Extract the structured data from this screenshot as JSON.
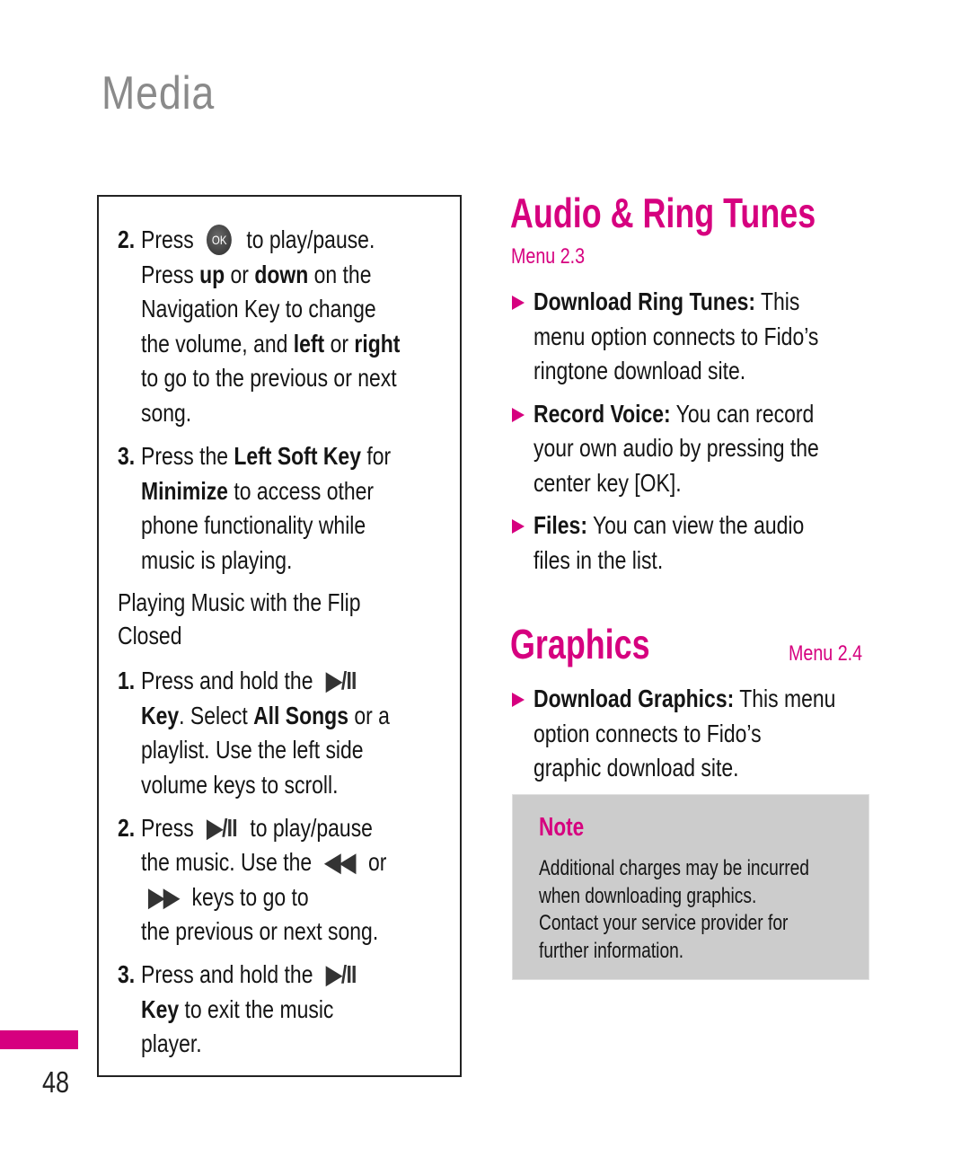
{
  "page": {
    "section_title": "Media",
    "page_number": "48",
    "accent_color": "#d6007f"
  },
  "left_box": {
    "flip_open_steps": [
      {
        "number": "2.",
        "lines": [
          {
            "parts": [
              {
                "t": "Press "
              },
              {
                "icon": "ok-button-icon",
                "label": "OK"
              },
              {
                "t": " to play/pause."
              }
            ]
          },
          {
            "parts": [
              {
                "t": "Press "
              },
              {
                "b": "up"
              },
              {
                "t": " or "
              },
              {
                "b": "down"
              },
              {
                "t": " on the"
              }
            ]
          },
          {
            "parts": [
              {
                "t": "Navigation Key to change"
              }
            ]
          },
          {
            "parts": [
              {
                "t": "the volume, and "
              },
              {
                "b": "left"
              },
              {
                "t": " or "
              },
              {
                "b": "right"
              }
            ]
          },
          {
            "parts": [
              {
                "t": "to go to the previous or next"
              }
            ]
          },
          {
            "parts": [
              {
                "t": "song."
              }
            ]
          }
        ]
      },
      {
        "number": "3.",
        "lines": [
          {
            "parts": [
              {
                "t": "Press the "
              },
              {
                "b": "Left Soft Key"
              },
              {
                "t": " for"
              }
            ]
          },
          {
            "parts": [
              {
                "b": "Minimize"
              },
              {
                "t": " to access other"
              }
            ]
          },
          {
            "parts": [
              {
                "t": "phone functionality while"
              }
            ]
          },
          {
            "parts": [
              {
                "t": "music is playing."
              }
            ]
          }
        ]
      }
    ],
    "subheading_lines": [
      "Playing Music with the Flip",
      "Closed"
    ],
    "flip_closed_steps": [
      {
        "number": "1.",
        "lines": [
          {
            "parts": [
              {
                "t": "Press and hold the "
              },
              {
                "icon": "play-pause-icon",
                "label": "▶/II"
              }
            ]
          },
          {
            "parts": [
              {
                "b": "Key"
              },
              {
                "t": ". Select "
              },
              {
                "b": "All Songs"
              },
              {
                "t": " or a"
              }
            ]
          },
          {
            "parts": [
              {
                "t": "playlist. Use the left side"
              }
            ]
          },
          {
            "parts": [
              {
                "t": "volume keys to scroll."
              }
            ]
          }
        ]
      },
      {
        "number": "2.",
        "lines": [
          {
            "parts": [
              {
                "t": "Press "
              },
              {
                "icon": "play-pause-icon",
                "label": "▶/II"
              },
              {
                "t": " to play/pause"
              }
            ]
          },
          {
            "parts": [
              {
                "t": "the music. Use the "
              },
              {
                "icon": "rewind-icon",
                "label": "◀◀"
              },
              {
                "t": " or"
              }
            ]
          },
          {
            "parts": [
              {
                "icon": "fast-forward-icon",
                "label": "▶▶"
              },
              {
                "t": " keys to go to"
              }
            ]
          },
          {
            "parts": [
              {
                "t": "the previous or next song."
              }
            ]
          }
        ]
      },
      {
        "number": "3.",
        "lines": [
          {
            "parts": [
              {
                "t": "Press and hold the "
              },
              {
                "icon": "play-pause-icon",
                "label": "▶/II"
              }
            ]
          },
          {
            "parts": [
              {
                "b": "Key"
              },
              {
                "t": " to exit the music"
              }
            ]
          },
          {
            "parts": [
              {
                "t": "player."
              }
            ]
          }
        ]
      }
    ]
  },
  "audio_section": {
    "title": "Audio & Ring Tunes",
    "menu": "Menu 2.3",
    "items": [
      {
        "label": "Download Ring Tunes:",
        "lines": [
          "This",
          "menu option connects to Fido’s",
          "ringtone download site."
        ]
      },
      {
        "label": "Record Voice:",
        "lines": [
          "You can record",
          "your own audio by pressing the",
          "center key [OK]."
        ]
      },
      {
        "label": "Files:",
        "lines": [
          "You can view the audio",
          "files in the list."
        ]
      }
    ]
  },
  "graphics_section": {
    "title": "Graphics",
    "menu": "Menu 2.4",
    "items": [
      {
        "label": "Download Graphics:",
        "lines": [
          "This menu",
          "option connects to Fido’s",
          "graphic download site."
        ]
      }
    ]
  },
  "note": {
    "title": "Note",
    "lines": [
      "Additional charges may be incurred",
      "when downloading graphics.",
      "Contact your service provider for",
      "further information."
    ]
  }
}
